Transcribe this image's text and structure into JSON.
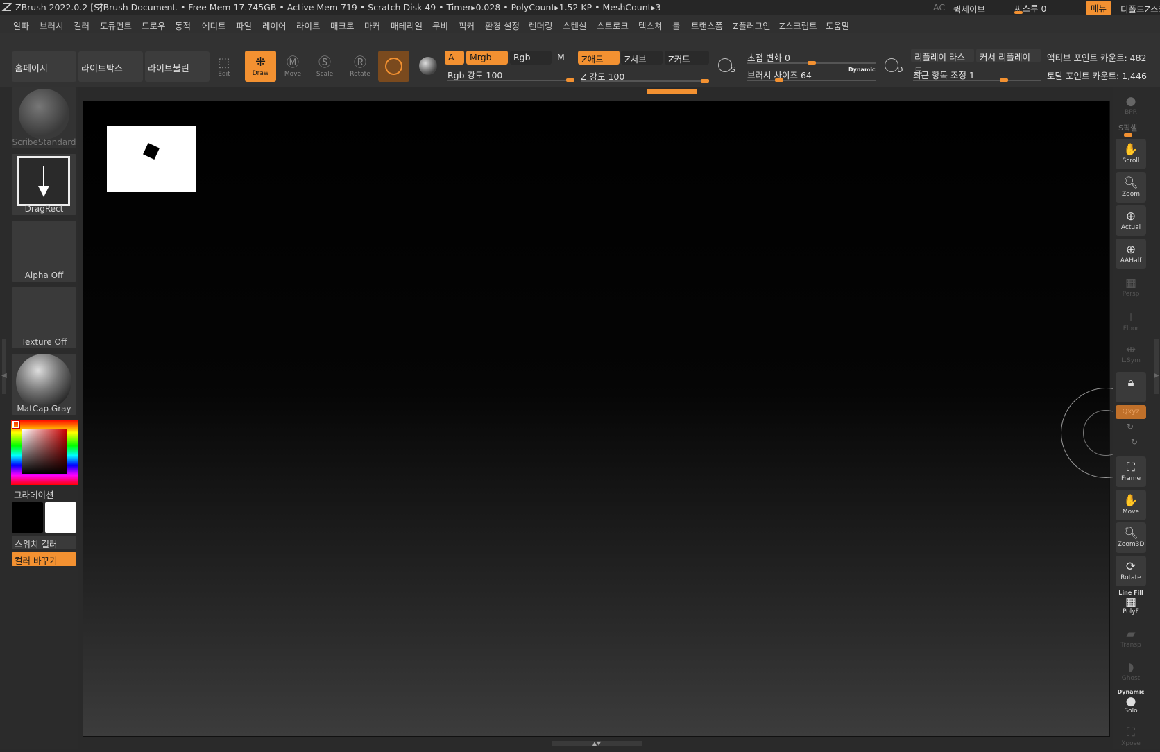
{
  "titlebar": {
    "app": "ZBrush 2022.0.2 [S]",
    "document": "ZBrush Document",
    "stats": ". • Free Mem 17.745GB • Active Mem 719 • Scratch Disk 49 •  Timer▸0.028 • PolyCount▸1.52 KP  • MeshCount▸3",
    "ac": "AC",
    "quicksave": "퀵세이브",
    "seethrough": "씨스루 0",
    "menu_btn": "메뉴",
    "default_script": "디폴트Z스크"
  },
  "menubar": [
    "알파",
    "브러시",
    "컬러",
    "도큐먼트",
    "드로우",
    "동적",
    "에디트",
    "파일",
    "레이어",
    "라이트",
    "매크로",
    "마커",
    "매테리얼",
    "무비",
    "픽커",
    "환경 설정",
    "렌더링",
    "스텐실",
    "스트로크",
    "텍스쳐",
    "툴",
    "트랜스폼",
    "Z플러그인",
    "Z스크립트",
    "도움말"
  ],
  "toolbar": {
    "home": "홈페이지",
    "lightbox": "라이트박스",
    "liveboolean": "라이브불린",
    "edit": "Edit",
    "draw": "Draw",
    "move": "Move",
    "scale": "Scale",
    "rotate": "Rotate",
    "a": "A",
    "mrgb": "Mrgb",
    "rgb": "Rgb",
    "m": "M",
    "zadd": "Z애드",
    "zsub": "Z서브",
    "zcut": "Z커트",
    "rgb_intensity": "Rgb 강도 100",
    "z_intensity": "Z 강도 100",
    "focal_shift": "초점 변화 0",
    "brush_size": "브러시 사이즈 64",
    "dynamic": "Dynamic",
    "replay_last": "리플레이 라스트",
    "cursor_replay": "커서 리플레이",
    "recent_adjust": "최근 항목 조정 1",
    "active_points": "액티브 포인트 카운트: 482",
    "total_points": "토탈 포인트 카운트: 1,446",
    "s_label": "S",
    "d_label": "D"
  },
  "leftpanel": {
    "brush": "ScribeStandard",
    "stroke": "DragRect",
    "alpha": "Alpha Off",
    "texture": "Texture Off",
    "material": "MatCap Gray",
    "gradient": "그라데이션",
    "switch_color": "스위치 컬러",
    "color_swap": "컬러 바꾸기"
  },
  "rightpanel": {
    "bpr": "BPR",
    "spix": "S픽셀",
    "scroll": "Scroll",
    "zoom": "Zoom",
    "actual": "Actual",
    "aahalf": "AAHalf",
    "persp": "Persp",
    "floor": "Floor",
    "lsym": "L.Sym",
    "xyz": "Qxyz",
    "frame": "Frame",
    "move": "Move",
    "zoom3d": "Zoom3D",
    "rotate": "Rotate",
    "linefill": "Line Fill",
    "polyf": "PolyF",
    "transp": "Transp",
    "ghost": "Ghost",
    "dynamic": "Dynamic",
    "solo": "Solo",
    "xpose": "Xpose"
  },
  "colors": {
    "accent": "#f39131",
    "primary_color": "#000000",
    "secondary_color": "#ffffff"
  }
}
